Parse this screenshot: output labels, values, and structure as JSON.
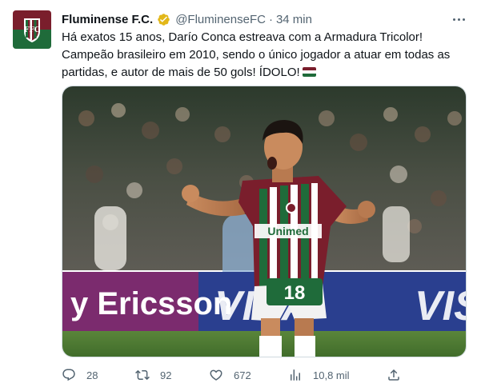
{
  "tweet": {
    "display_name": "Fluminense F.C.",
    "verified_icon": "verified-badge-gold",
    "handle": "@FluminenseFC",
    "separator": "·",
    "time": "34 min",
    "text_line1": "Há exatos 15 anos, Darío Conca estreava com a Armadura Tricolor!",
    "text_line2": "Campeão brasileiro em 2010, sendo o único jogador a atuar em todas as",
    "text_line3": "partidas, e autor de mais de 50 gols! ÍDOLO!",
    "emoji": "flag-tricolor",
    "more_icon": "more-options-icon",
    "media": {
      "ad_board_left": "y Ericsson",
      "ad_board_right": "VISA",
      "ad_board_right_2": "VIS",
      "shirt_sponsor": "Unimed",
      "shirt_number": "18",
      "sleeve_text": "Unimed"
    },
    "actions": {
      "reply_count": "28",
      "retweet_count": "92",
      "like_count": "672",
      "views_count": "10,8 mil",
      "share_label": ""
    },
    "colors": {
      "grena": "#7a1e2c",
      "green": "#1f6b3a",
      "white": "#ffffff",
      "verified_gold": "#e2b719"
    }
  }
}
